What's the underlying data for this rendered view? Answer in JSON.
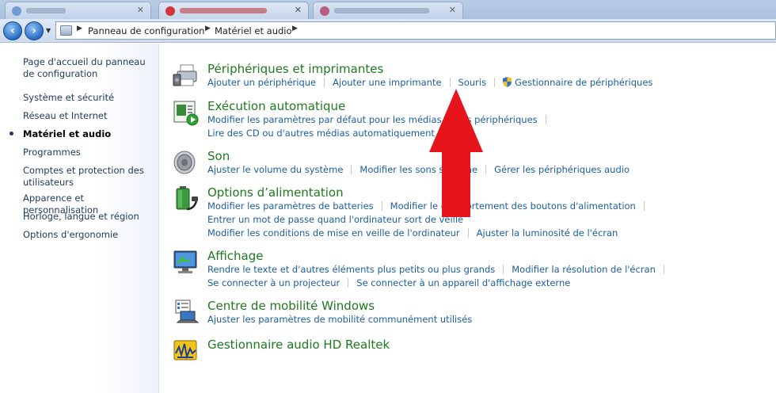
{
  "address": {
    "crumbs": [
      "Panneau de configuration",
      "Matériel et audio"
    ]
  },
  "left_nav": {
    "items": [
      {
        "label": "Page d'accueil du panneau de configuration",
        "active": false
      },
      {
        "label": "Système et sécurité",
        "active": false
      },
      {
        "label": "Réseau et Internet",
        "active": false
      },
      {
        "label": "Matériel et audio",
        "active": true
      },
      {
        "label": "Programmes",
        "active": false
      },
      {
        "label": "Comptes et protection des utilisateurs",
        "active": false
      },
      {
        "label": "Apparence et personnalisation",
        "active": false
      },
      {
        "label": "Horloge, langue et région",
        "active": false
      },
      {
        "label": "Options d'ergonomie",
        "active": false
      }
    ]
  },
  "categories": [
    {
      "title": "Périphériques et imprimantes",
      "icon": "printer-icon",
      "rows": [
        [
          "Ajouter un périphérique",
          "Ajouter une imprimante",
          "Souris",
          "Gestionnaire de périphériques"
        ]
      ]
    },
    {
      "title": "Exécution automatique",
      "icon": "autoplay-icon",
      "rows": [
        [
          "Modifier les paramètres par défaut pour les médias ou les périphériques"
        ],
        [
          "Lire des CD ou d'autres médias automatiquement"
        ]
      ]
    },
    {
      "title": "Son",
      "icon": "speaker-icon",
      "rows": [
        [
          "Ajuster le volume du système",
          "Modifier les sons système",
          "Gérer les périphériques audio"
        ]
      ]
    },
    {
      "title": "Options d’alimentation",
      "icon": "battery-icon",
      "rows": [
        [
          "Modifier les paramètres de batteries",
          "Modifier le comportement des boutons d'alimentation"
        ],
        [
          "Entrer un mot de passe quand l'ordinateur sort de veille"
        ],
        [
          "Modifier les conditions de mise en veille de l'ordinateur",
          "Ajuster la luminosité de l'écran"
        ]
      ]
    },
    {
      "title": "Affichage",
      "icon": "display-icon",
      "rows": [
        [
          "Rendre le texte et d'autres éléments plus petits ou plus grands",
          "Modifier la résolution de l'écran"
        ],
        [
          "Se connecter à un projecteur",
          "Se connecter à un appareil d'affichage externe"
        ]
      ]
    },
    {
      "title": "Centre de mobilité Windows",
      "icon": "mobility-icon",
      "rows": [
        [
          "Ajuster les paramètres de mobilité communément utilisés"
        ]
      ]
    },
    {
      "title": "Gestionnaire audio HD Realtek",
      "icon": "realtek-audio-icon",
      "rows": []
    }
  ],
  "colors": {
    "title_green": "#1e7a1e",
    "link_blue": "#1a5e9f",
    "arrow_red": "#e8141c"
  }
}
